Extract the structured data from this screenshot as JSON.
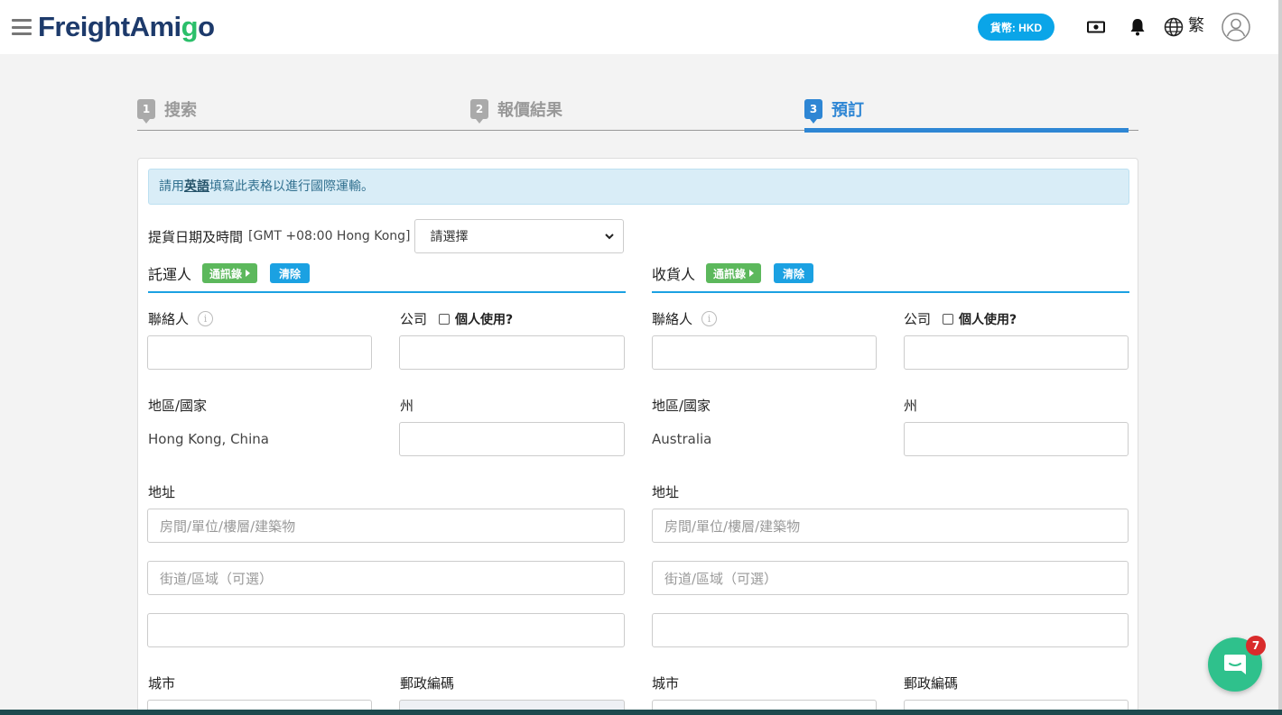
{
  "header": {
    "logo_part1": "Freight",
    "logo_part2": "Ami",
    "logo_part3": "g",
    "logo_part4": "o",
    "currency_label": "貨幣: HKD",
    "language_label": "繁",
    "icons": [
      "menu-icon",
      "currency-icon",
      "bell-icon",
      "globe-icon",
      "user-icon"
    ]
  },
  "steps": [
    {
      "number": "1",
      "label": "搜索"
    },
    {
      "number": "2",
      "label": "報價結果"
    },
    {
      "number": "3",
      "label": "預訂"
    }
  ],
  "notice": {
    "prefix": "請用",
    "link": "英語",
    "suffix": "填寫此表格以進行國際運輸。"
  },
  "pickup": {
    "label": "提貨日期及時間",
    "timezone": "[GMT +08:00 Hong Kong]",
    "select_value": "請選擇"
  },
  "shipper": {
    "title": "託運人",
    "address_book": "通訊錄",
    "clear": "清除",
    "contact_label": "聯絡人",
    "company_label": "公司",
    "personal_use_label": "個人使用?",
    "country_label": "地區/國家",
    "country_value": "Hong Kong, China",
    "state_label": "州",
    "address_label": "地址",
    "address1_placeholder": "房間/單位/樓層/建築物",
    "address2_placeholder": "街道/區域（可選）",
    "city_label": "城市",
    "postal_label": "郵政編碼"
  },
  "consignee": {
    "title": "收貨人",
    "address_book": "通訊錄",
    "clear": "清除",
    "contact_label": "聯絡人",
    "company_label": "公司",
    "personal_use_label": "個人使用?",
    "country_label": "地區/國家",
    "country_value": "Australia",
    "state_label": "州",
    "address_label": "地址",
    "address1_placeholder": "房間/單位/樓層/建築物",
    "address2_placeholder": "街道/區域（可選）",
    "city_label": "城市",
    "postal_label": "郵政編碼"
  },
  "chat": {
    "badge_count": "7"
  },
  "colors": {
    "brand_dark": "#1d3a6b",
    "brand_green": "#2bbf6a",
    "accent_blue": "#1ba1e2",
    "step_active": "#2e86d4",
    "btn_green": "#5cb85c",
    "chat_green": "#2fc18c"
  }
}
